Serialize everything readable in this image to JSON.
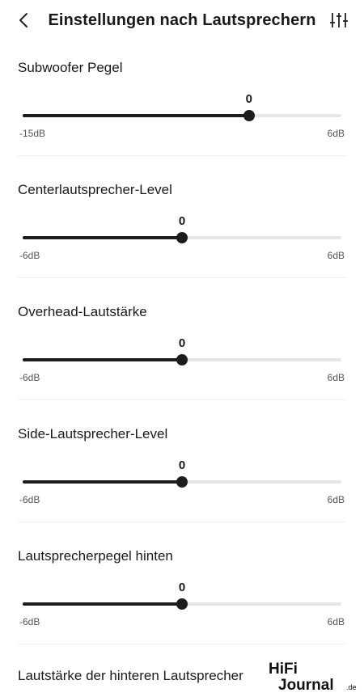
{
  "header": {
    "title": "Einstellungen nach Lautsprechern",
    "back_icon": "chevron-left-icon",
    "settings_icon": "equalizer-sliders-icon"
  },
  "sections": [
    {
      "label": "Subwoofer Pegel",
      "value": "0",
      "min": "-15dB",
      "max": "6dB",
      "fraction": 0.71
    },
    {
      "label": "Centerlautsprecher-Level",
      "value": "0",
      "min": "-6dB",
      "max": "6dB",
      "fraction": 0.5
    },
    {
      "label": "Overhead-Lautstärke",
      "value": "0",
      "min": "-6dB",
      "max": "6dB",
      "fraction": 0.5
    },
    {
      "label": "Side-Lautsprecher-Level",
      "value": "0",
      "min": "-6dB",
      "max": "6dB",
      "fraction": 0.5
    },
    {
      "label": "Lautsprecherpegel hinten",
      "value": "0",
      "min": "-6dB",
      "max": "6dB",
      "fraction": 0.5
    }
  ],
  "last_section": {
    "label": "Lautstärke der hinteren Lautsprecher"
  },
  "watermark": {
    "line1": "HiFi",
    "line2": "Journal",
    "suffix": ".de"
  },
  "colors": {
    "track_active": "#1c1c1c",
    "track_inactive": "#e6e6e6"
  }
}
